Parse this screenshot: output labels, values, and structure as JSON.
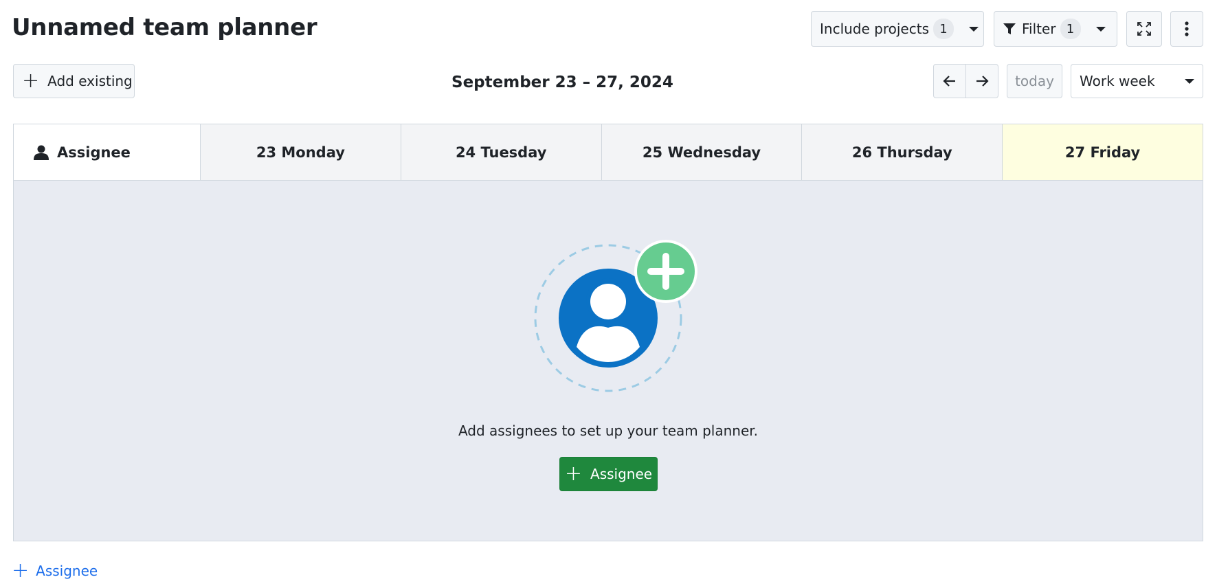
{
  "page": {
    "title": "Unnamed team planner"
  },
  "toolbar": {
    "include_projects_label": "Include projects",
    "include_projects_count": "1",
    "filter_label": "Filter",
    "filter_count": "1",
    "fullscreen_icon": "fullscreen-icon",
    "more_icon": "more-vertical-icon"
  },
  "subtoolbar": {
    "add_existing_label": "Add existing",
    "date_range": "September 23 – 27, 2024",
    "prev_icon": "arrow-left-icon",
    "next_icon": "arrow-right-icon",
    "today_label": "today",
    "view_mode": "Work week"
  },
  "planner": {
    "assignee_header": "Assignee",
    "days": [
      {
        "label": "23 Monday",
        "today": false
      },
      {
        "label": "24 Tuesday",
        "today": false
      },
      {
        "label": "25 Wednesday",
        "today": false
      },
      {
        "label": "26 Thursday",
        "today": false
      },
      {
        "label": "27 Friday",
        "today": true
      }
    ],
    "empty_state_text": "Add assignees to set up your team planner.",
    "empty_state_button": "Assignee"
  },
  "footer": {
    "add_assignee_label": "Assignee"
  },
  "colors": {
    "primary_button": "#1f883d",
    "link": "#1f6feb",
    "today_highlight": "#fefee0",
    "avatar_blue": "#0b72c5",
    "plus_badge_green": "#66cc90"
  }
}
